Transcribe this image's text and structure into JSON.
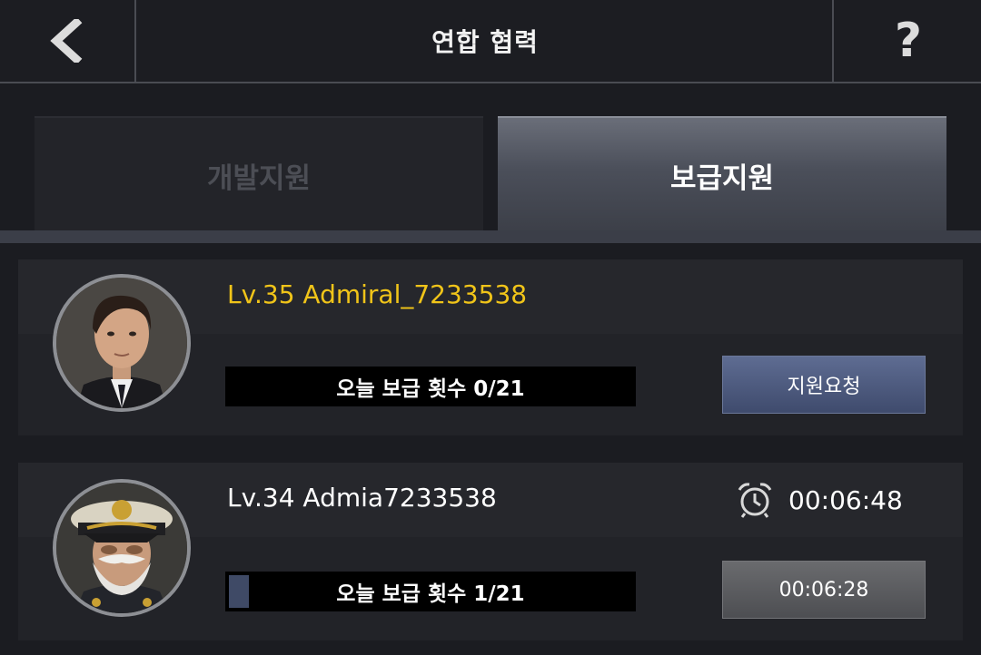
{
  "header": {
    "title": "연합 협력",
    "back_icon": "chevron-left-icon",
    "help_label": "?"
  },
  "tabs": [
    {
      "label": "개발지원",
      "active": false
    },
    {
      "label": "보급지원",
      "active": true
    }
  ],
  "members": [
    {
      "name": "Lv.35 Admiral_7233538",
      "name_color": "#f0c419",
      "supply_label": "오늘 보급 횟수 0/21",
      "supply_progress": 0,
      "button_label": "지원요청",
      "avatar": "businessman-portrait"
    },
    {
      "name": "Lv.34 Admia7233538",
      "name_color": "#ffffff",
      "timer_icon": "alarm-clock-icon",
      "timer": "00:06:48",
      "supply_label": "오늘 보급 횟수 1/21",
      "supply_progress": 0.048,
      "button_label": "00:06:28",
      "avatar": "admiral-portrait"
    }
  ],
  "colors": {
    "accent_yellow": "#f0c419",
    "active_tab": "#4b4f5a",
    "request_button": "#4a5780"
  }
}
